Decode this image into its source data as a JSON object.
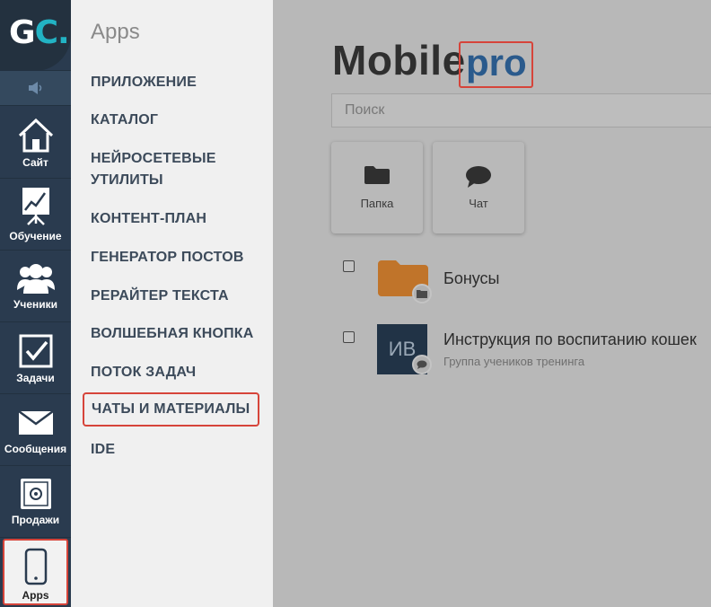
{
  "logo": {
    "text_main": "G",
    "text_accent": "C."
  },
  "rail": {
    "items": [
      {
        "label": "Сайт",
        "icon": "home-icon"
      },
      {
        "label": "Обучение",
        "icon": "chart-board-icon"
      },
      {
        "label": "Ученики",
        "icon": "users-icon"
      },
      {
        "label": "Задачи",
        "icon": "checkbox-icon"
      },
      {
        "label": "Сообщения",
        "icon": "envelope-icon"
      },
      {
        "label": "Продажи",
        "icon": "safe-icon"
      },
      {
        "label": "Apps",
        "icon": "smartphone-icon"
      }
    ]
  },
  "menu": {
    "title": "Apps",
    "items": [
      "ПРИЛОЖЕНИЕ",
      "КАТАЛОГ",
      "НЕЙРОСЕТЕВЫЕ УТИЛИТЫ",
      "КОНТЕНТ-ПЛАН",
      "ГЕНЕРАТОР ПОСТОВ",
      "РЕРАЙТЕР ТЕКСТА",
      "ВОЛШЕБНАЯ КНОПКА",
      "ПОТОК ЗАДАЧ",
      "ЧАТЫ И МАТЕРИАЛЫ",
      "IDE"
    ],
    "selected": "ЧАТЫ И МАТЕРИАЛЫ"
  },
  "main": {
    "title_word": "Mobile",
    "title_badge": "pro",
    "search_placeholder": "Поиск",
    "tiles": [
      {
        "label": "Папка",
        "icon": "folder-icon"
      },
      {
        "label": "Чат",
        "icon": "chat-bubble-icon"
      }
    ],
    "rows": [
      {
        "name": "Бонусы",
        "type": "folder",
        "badge_icon": "folder-icon"
      },
      {
        "name": "Инструкция по воспитанию кошек",
        "subtitle": "Группа учеников тренинга",
        "avatar": "ИВ",
        "type": "chat",
        "badge_icon": "chat-bubble-icon"
      }
    ]
  },
  "colors": {
    "rail_bg": "#2a3b4f",
    "menu_bg": "#f0f0f0",
    "main_bg": "#b8b8b8",
    "highlight": "#d6443a",
    "accent": "#22b3c4",
    "pro_blue": "#2a5a8c",
    "folder_orange": "#c0742a"
  }
}
